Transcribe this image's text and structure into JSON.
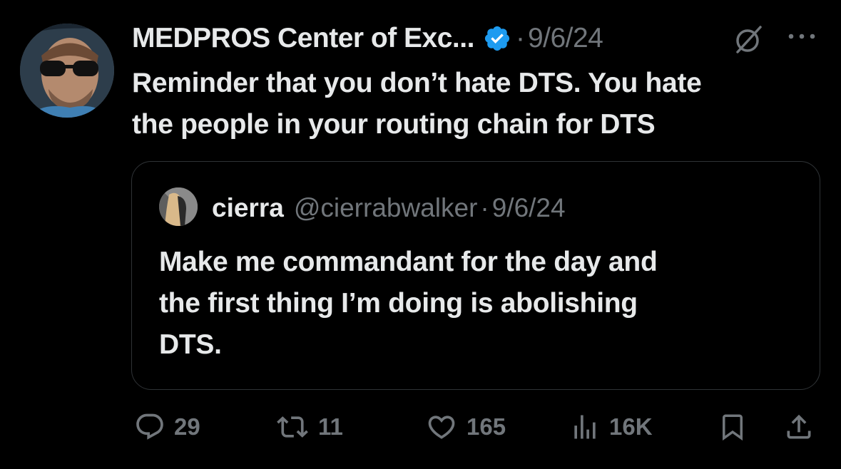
{
  "tweet": {
    "author_name": "MEDPROS Center of Exc...",
    "separator": "·",
    "date": "9/6/24",
    "verified": true,
    "text": "Reminder that you don’t hate DTS. You hate\nthe people in your routing chain for DTS"
  },
  "quoted_tweet": {
    "author_name": "cierra",
    "handle": "@cierrabwalker",
    "separator": "·",
    "date": "9/6/24",
    "text": "Make me commandant for the day and\nthe first thing I’m doing is abolishing\nDTS."
  },
  "actions": {
    "reply": {
      "icon": "reply-icon",
      "count": "29"
    },
    "repost": {
      "icon": "repost-icon",
      "count": "11"
    },
    "like": {
      "icon": "heart-icon",
      "count": "165"
    },
    "views": {
      "icon": "views-icon",
      "count": "16K"
    },
    "bookmark": {
      "icon": "bookmark-icon"
    },
    "share": {
      "icon": "share-icon"
    }
  },
  "colors": {
    "background": "#000000",
    "primary_text": "#e7e9ea",
    "secondary_text": "#71767b",
    "border": "#2f3336",
    "verified_blue": "#1d9bf0"
  }
}
